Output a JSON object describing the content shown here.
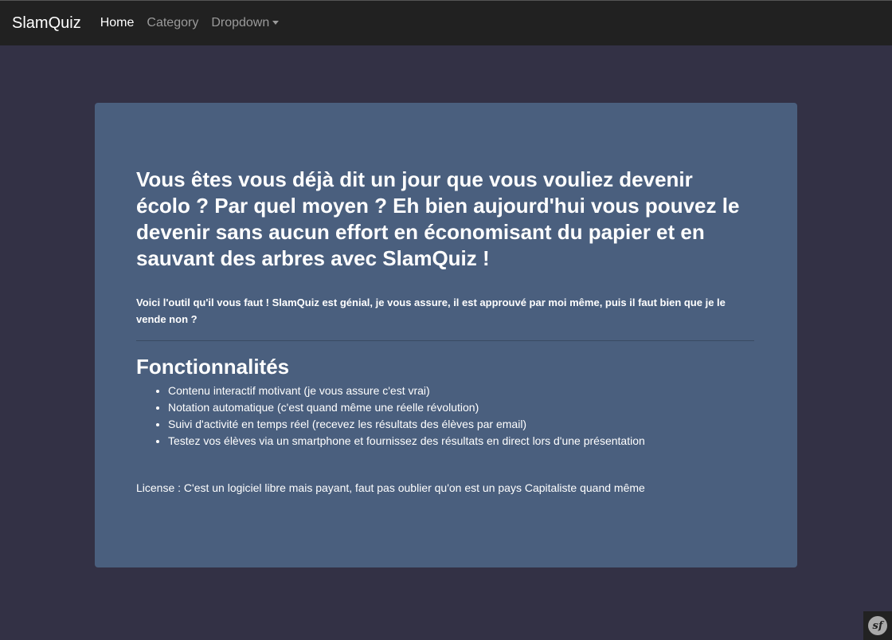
{
  "navbar": {
    "brand": "SlamQuiz",
    "links": [
      {
        "label": "Home"
      },
      {
        "label": "Category"
      },
      {
        "label": "Dropdown"
      }
    ]
  },
  "hero": {
    "title": "Vous êtes vous déjà dit un jour que vous vouliez devenir écolo ? Par quel moyen ? Eh bien aujourd'hui vous pouvez le devenir sans aucun effort en économisant du papier et en sauvant des arbres avec SlamQuiz !",
    "lead": "Voici l'outil qu'il vous faut ! SlamQuiz est génial, je vous assure, il est approuvé par moi même, puis il faut bien que je le vende non ?"
  },
  "features": {
    "title": "Fonctionnalités",
    "items": [
      "Contenu interactif motivant (je vous assure c'est vrai)",
      "Notation automatique (c'est quand même une réelle révolution)",
      "Suivi d'activité en temps réel (recevez les résultats des élèves par email)",
      "Testez vos élèves via un smartphone et fournissez des résultats en direct lors d'une présentation"
    ]
  },
  "license": "License : C'est un logiciel libre mais payant, faut pas oublier qu'on est un pays Capitaliste quand même",
  "toolbar": {
    "icon": "symfony-icon",
    "logo_text": "sf"
  },
  "colors": {
    "page_bg": "#333145",
    "navbar_bg": "#212121",
    "jumbotron_bg": "#4a5f7e"
  }
}
